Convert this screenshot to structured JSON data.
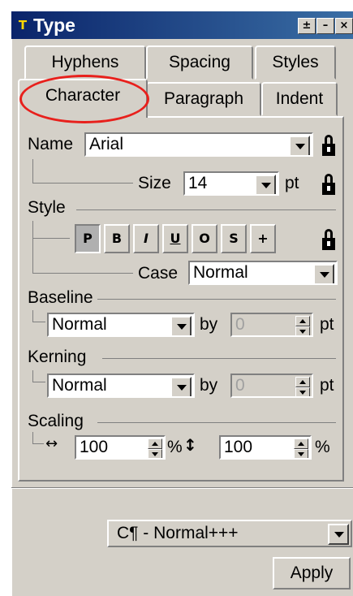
{
  "window": {
    "title": "Type",
    "icon": "type-app-icon"
  },
  "title_buttons": [
    "pin-icon",
    "minimize-icon",
    "close-icon"
  ],
  "tabs": {
    "row1": [
      "Hyphens",
      "Spacing",
      "Styles"
    ],
    "row2": [
      "Character",
      "Paragraph",
      "Indent"
    ],
    "active": "Character"
  },
  "labels": {
    "name": "Name",
    "size": "Size",
    "pt": "pt",
    "style": "Style",
    "case": "Case",
    "baseline": "Baseline",
    "by": "by",
    "kerning": "Kerning",
    "scaling": "Scaling",
    "percent": "%"
  },
  "fields": {
    "name": "Arial",
    "size": "14",
    "case": "Normal",
    "baseline": "Normal",
    "baseline_by": "0",
    "kerning": "Normal",
    "kerning_by": "0",
    "scale_h": "100",
    "scale_v": "100"
  },
  "style_buttons": [
    "P",
    "B",
    "I",
    "U",
    "O",
    "S",
    "+"
  ],
  "bottom": {
    "preset": "C¶ - Normal+++",
    "apply": "Apply"
  },
  "colors": {
    "title_start": "#0a246a",
    "title_end": "#3a6ea5",
    "face": "#d4d0c8",
    "highlight_circle": "#e8201c"
  }
}
